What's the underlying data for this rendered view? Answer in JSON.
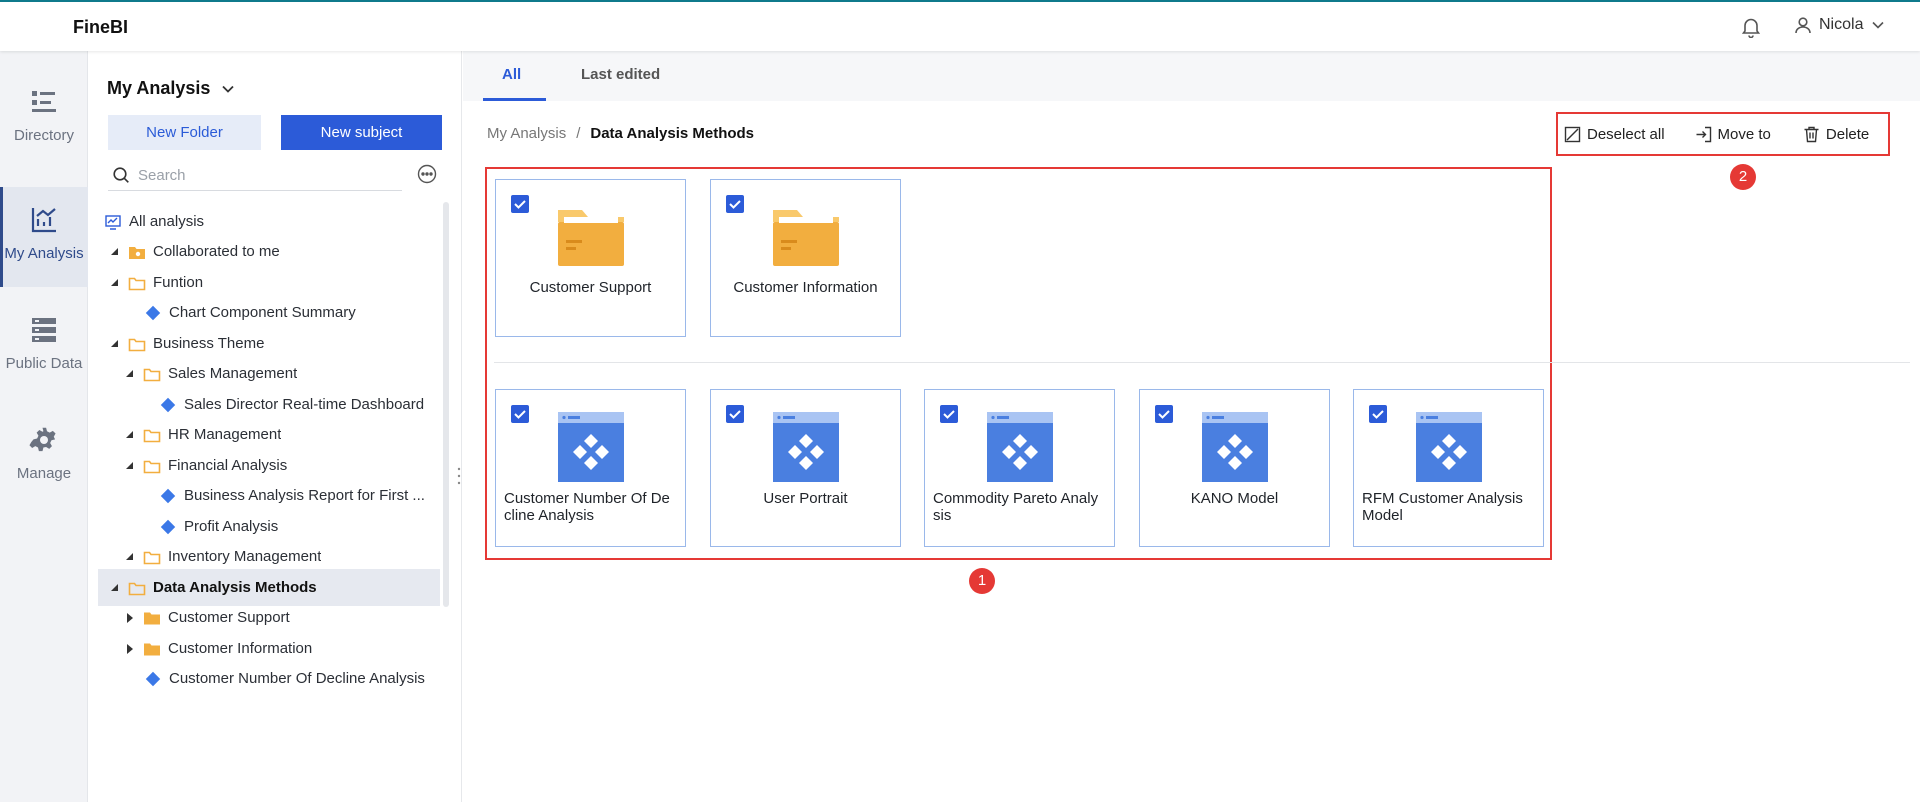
{
  "app": {
    "brand": "FineBI"
  },
  "header": {
    "user_name": "Nicola"
  },
  "rail": {
    "items": [
      {
        "label": "Directory",
        "icon": "directory-icon"
      },
      {
        "label": "My Analysis",
        "icon": "analysis-chart-icon",
        "active": true
      },
      {
        "label": "Public Data",
        "icon": "public-data-icon"
      },
      {
        "label": "Manage",
        "icon": "manage-gear-icon"
      }
    ]
  },
  "panel": {
    "title": "My Analysis",
    "new_folder_label": "New Folder",
    "new_subject_label": "New subject",
    "search_placeholder": "Search"
  },
  "tree": [
    {
      "label": "All analysis",
      "type": "monitor"
    },
    {
      "label": "Collaborated to me",
      "type": "shared-folder",
      "expanded": true
    },
    {
      "label": "Funtion",
      "type": "folder-open",
      "expanded": true
    },
    {
      "label": "Chart Component Summary",
      "type": "subject"
    },
    {
      "label": "Business Theme",
      "type": "folder-open",
      "expanded": true
    },
    {
      "label": "Sales Management",
      "type": "folder-open",
      "expanded": true
    },
    {
      "label": "Sales Director Real-time Dashboard",
      "type": "subject"
    },
    {
      "label": "HR Management",
      "type": "folder-open",
      "expanded": true
    },
    {
      "label": "Financial Analysis",
      "type": "folder-open",
      "expanded": true
    },
    {
      "label": "Business Analysis Report for First ...",
      "type": "subject"
    },
    {
      "label": "Profit Analysis",
      "type": "subject"
    },
    {
      "label": "Inventory Management",
      "type": "folder-open",
      "expanded": true
    },
    {
      "label": "Data Analysis Methods",
      "type": "folder-open",
      "expanded": true,
      "selected": true
    },
    {
      "label": "Customer Support",
      "type": "folder",
      "expanded": false
    },
    {
      "label": "Customer Information",
      "type": "folder",
      "expanded": false
    },
    {
      "label": "Customer Number Of Decline Analysis",
      "type": "subject"
    }
  ],
  "tabs": {
    "all": "All",
    "last_edited": "Last edited"
  },
  "breadcrumb": {
    "parent": "My Analysis",
    "separator": "/",
    "current": "Data Analysis Methods"
  },
  "toolbar": {
    "deselect_all": "Deselect all",
    "move_to": "Move to",
    "delete": "Delete"
  },
  "markers": {
    "cards": "1",
    "toolbar": "2"
  },
  "folders": [
    {
      "title": "Customer Support",
      "checked": true
    },
    {
      "title": "Customer Information",
      "checked": true
    }
  ],
  "subjects": [
    {
      "title": "Customer Number Of De cline Analysis",
      "checked": true
    },
    {
      "title": "User Portrait",
      "checked": true
    },
    {
      "title": "Commodity Pareto Analy sis",
      "checked": true
    },
    {
      "title": "KANO Model",
      "checked": true
    },
    {
      "title": "RFM Customer Analysis Model",
      "checked": true
    }
  ],
  "colors": {
    "accent": "#2c5bd8",
    "annotation": "#e53935",
    "folder": "#f2ae3f",
    "topbar_line": "#0f7a8c"
  }
}
